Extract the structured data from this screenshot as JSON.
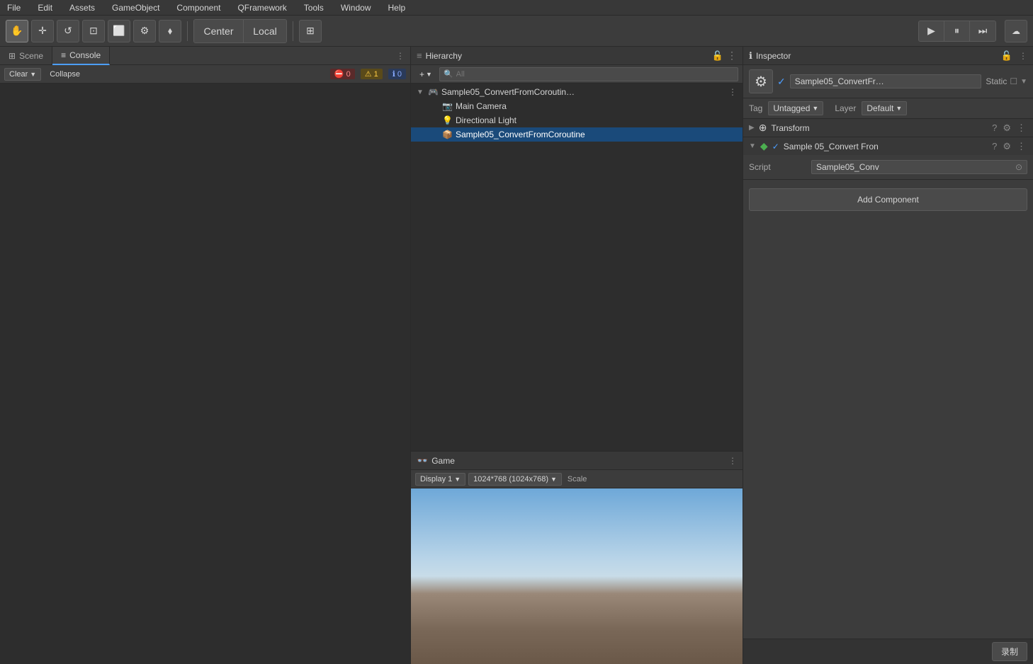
{
  "menu": {
    "items": [
      "File",
      "Edit",
      "Assets",
      "GameObject",
      "Component",
      "QFramework",
      "Tools",
      "Window",
      "Help"
    ]
  },
  "toolbar": {
    "tools": [
      {
        "name": "hand",
        "icon": "✋",
        "active": true
      },
      {
        "name": "move",
        "icon": "✛"
      },
      {
        "name": "rotate",
        "icon": "↺"
      },
      {
        "name": "scale",
        "icon": "⊡"
      },
      {
        "name": "rect",
        "icon": "⬜"
      },
      {
        "name": "transform",
        "icon": "⚙"
      },
      {
        "name": "multi",
        "icon": "⬧"
      }
    ],
    "pivot_center": "Center",
    "pivot_local": "Local",
    "grid_btn": "⊞",
    "play_btn": "▶",
    "pause_btn": "⏸",
    "step_btn": "⏭",
    "cloud_btn": "☁"
  },
  "console": {
    "tab_scene": "Scene",
    "tab_console": "Console",
    "clear_label": "Clear",
    "collapse_label": "Collapse",
    "badge_error_count": "0",
    "badge_warn_count": "1",
    "badge_info_count": "0",
    "badge_error_icon": "⛔",
    "badge_warn_icon": "⚠",
    "badge_info_icon": "ℹ"
  },
  "hierarchy": {
    "title": "Hierarchy",
    "add_label": "+",
    "search_placeholder": "All",
    "items": [
      {
        "id": "root",
        "label": "Sample05_ConvertFromCoroutin…",
        "indent": 0,
        "has_arrow": true,
        "icon": "🎮",
        "selected": false,
        "has_more": true
      },
      {
        "id": "main_camera",
        "label": "Main Camera",
        "indent": 1,
        "has_arrow": false,
        "icon": "📷",
        "selected": false
      },
      {
        "id": "dir_light",
        "label": "Directional Light",
        "indent": 1,
        "has_arrow": false,
        "icon": "💡",
        "selected": false
      },
      {
        "id": "sample05",
        "label": "Sample05_ConvertFromCoroutine",
        "indent": 1,
        "has_arrow": false,
        "icon": "📦",
        "selected": true
      }
    ]
  },
  "game": {
    "title": "Game",
    "display_label": "Display 1",
    "resolution_label": "1024*768 (1024x768)",
    "scale_label": "Scale"
  },
  "inspector": {
    "title": "Inspector",
    "obj_name": "Sample05_ConvertFr…",
    "static_label": "Static",
    "tag_label": "Tag",
    "tag_value": "Untagged",
    "layer_label": "Layer",
    "layer_value": "Default",
    "transform_label": "Transform",
    "script_comp_label": "Sample 05_Convert Fron",
    "script_label": "Script",
    "script_value": "Sample05_Conv",
    "add_component_label": "Add Component",
    "record_label": "录制"
  }
}
